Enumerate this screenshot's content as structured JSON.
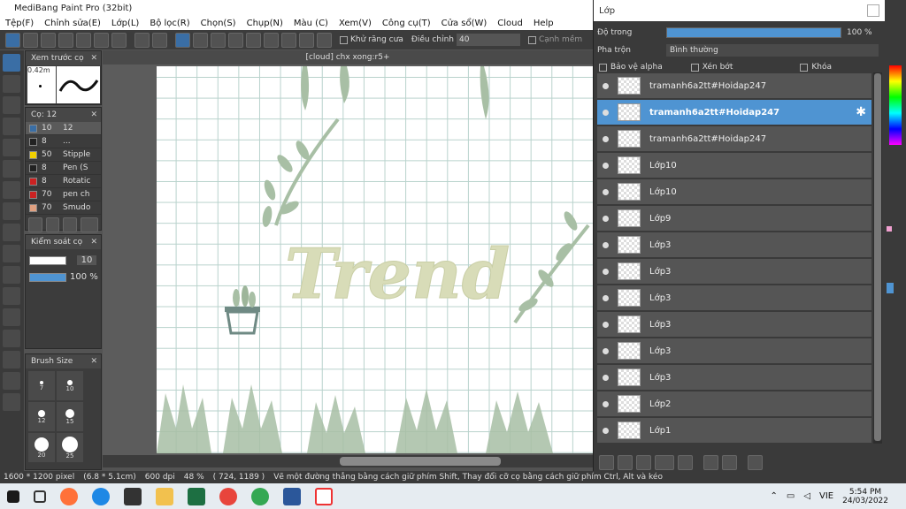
{
  "window": {
    "title": "MediBang Paint Pro (32bit)"
  },
  "menu": [
    "Tệp(F)",
    "Chỉnh sửa(E)",
    "Lớp(L)",
    "Bộ lọc(R)",
    "Chọn(S)",
    "Chụp(N)",
    "Màu (C)",
    "Xem(V)",
    "Công cụ(T)",
    "Cửa sổ(W)",
    "Cloud",
    "Help"
  ],
  "toolbar": {
    "antialias": "Khử răng cưa",
    "adjust_label": "Điều chỉnh",
    "adjust_value": "40",
    "smooth": "Cạnh mềm"
  },
  "preview": {
    "title": "Xem trước cọ",
    "size": "0.42m"
  },
  "brush_panel": {
    "title": "Cọ: 12",
    "items": [
      {
        "size": "10",
        "name": "12",
        "color": "#3a6ea5",
        "selected": true
      },
      {
        "size": "8",
        "name": "...",
        "color": "#222222"
      },
      {
        "size": "50",
        "name": "Stipple",
        "color": "#f0d000"
      },
      {
        "size": "8",
        "name": "Pen (S",
        "color": "#222222"
      },
      {
        "size": "8",
        "name": "Rotatic",
        "color": "#cc2222"
      },
      {
        "size": "70",
        "name": "pen ch",
        "color": "#cc2222"
      },
      {
        "size": "70",
        "name": "Smudo",
        "color": "#e0a080"
      }
    ]
  },
  "control_panel": {
    "title": "Kiểm soát cọ",
    "size_value": "10",
    "opacity_value": "100 %"
  },
  "brush_size_panel": {
    "title": "Brush Size",
    "sizes": [
      "7",
      "10",
      "12",
      "15",
      "20",
      "25"
    ]
  },
  "document": {
    "tab": "[cloud] chx xong:r5+",
    "artwork_text": "Trend"
  },
  "layer_panel": {
    "title": "Lớp",
    "opacity_label": "Độ trong",
    "opacity_value": "100 %",
    "opacity_fraction": 1.0,
    "blend_label": "Pha trộn",
    "blend_value": "Bình thường",
    "alpha_protect": "Bảo vệ alpha",
    "clipping": "Xén bớt",
    "lock": "Khóa",
    "layers": [
      {
        "name": "tramanh6a2tt#Hoidap247",
        "selected": false
      },
      {
        "name": "tramanh6a2tt#Hoidap247",
        "selected": true
      },
      {
        "name": "tramanh6a2tt#Hoidap247",
        "selected": false
      },
      {
        "name": "Lớp10",
        "selected": false
      },
      {
        "name": "Lớp10",
        "selected": false
      },
      {
        "name": "Lớp9",
        "selected": false
      },
      {
        "name": "Lớp3",
        "selected": false
      },
      {
        "name": "Lớp3",
        "selected": false
      },
      {
        "name": "Lớp3",
        "selected": false
      },
      {
        "name": "Lớp3",
        "selected": false
      },
      {
        "name": "Lớp3",
        "selected": false
      },
      {
        "name": "Lớp3",
        "selected": false
      },
      {
        "name": "Lớp2",
        "selected": false
      },
      {
        "name": "Lớp1",
        "selected": false
      }
    ]
  },
  "statusbar": {
    "size": "1600 * 1200 pixel",
    "physical": "(6.8 * 5.1cm)",
    "dpi": "600 dpi",
    "zoom": "48 %",
    "coords": "( 724, 1189 )",
    "hint": "Vẽ một đường thẳng bằng cách giữ phím Shift, Thay đổi cỡ cọ bằng cách giữ phím Ctrl, Alt và kéo"
  },
  "taskbar": {
    "lang": "VIE",
    "time": "5:54 PM",
    "date": "24/03/2022"
  },
  "colors": {
    "accent": "#4f94d2",
    "leaf": "#9db59a",
    "text_art": "#d8dcb8"
  }
}
